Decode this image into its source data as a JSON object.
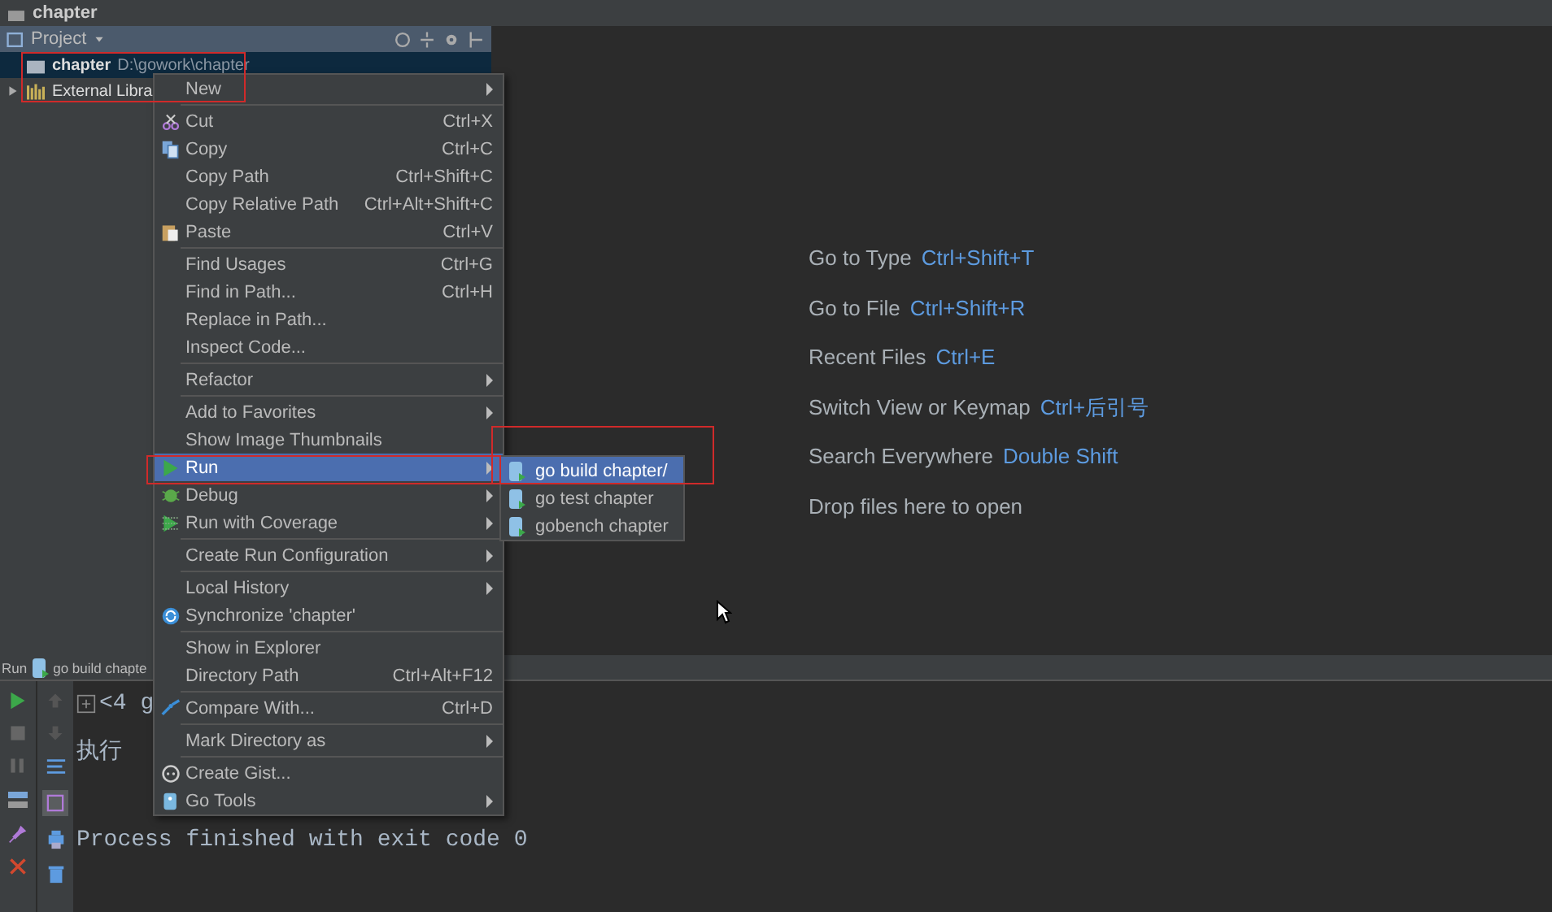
{
  "top_bar": {
    "title": "chapter"
  },
  "project_panel": {
    "title": "Project",
    "tree": [
      {
        "name": "chapter",
        "path": "D:\\gowork\\chapter",
        "selected": true,
        "expandable": false
      },
      {
        "name": "External Libra",
        "selected": false,
        "expandable": true
      }
    ]
  },
  "editor_hints": [
    {
      "label": "Go to Type",
      "shortcut": "Ctrl+Shift+T"
    },
    {
      "label": "Go to File",
      "shortcut": "Ctrl+Shift+R"
    },
    {
      "label": "Recent Files",
      "shortcut": "Ctrl+E"
    },
    {
      "label": "Switch View or Keymap",
      "shortcut": "Ctrl+后引号"
    },
    {
      "label": "Search Everywhere",
      "shortcut": "Double Shift"
    },
    {
      "label": "Drop files here to open"
    }
  ],
  "run_panel": {
    "title": "Run",
    "config": "go build chapte",
    "console": [
      "<4 g",
      "执行",
      "Process finished with exit code 0"
    ]
  },
  "context_menu": [
    {
      "kind": "item",
      "label": "New",
      "submenu": true,
      "selected": false
    },
    {
      "kind": "separator"
    },
    {
      "kind": "item",
      "label": "Cut",
      "shortcut": "Ctrl+X",
      "submenu": false,
      "selected": false
    },
    {
      "kind": "item",
      "label": "Copy",
      "shortcut": "Ctrl+C",
      "submenu": false,
      "selected": false
    },
    {
      "kind": "item",
      "label": "Copy Path",
      "shortcut": "Ctrl+Shift+C",
      "submenu": false,
      "selected": false
    },
    {
      "kind": "item",
      "label": "Copy Relative Path",
      "shortcut": "Ctrl+Alt+Shift+C",
      "submenu": false,
      "selected": false
    },
    {
      "kind": "item",
      "label": "Paste",
      "shortcut": "Ctrl+V",
      "submenu": false,
      "selected": false
    },
    {
      "kind": "separator"
    },
    {
      "kind": "item",
      "label": "Find Usages",
      "shortcut": "Ctrl+G",
      "submenu": false,
      "selected": false
    },
    {
      "kind": "item",
      "label": "Find in Path...",
      "shortcut": "Ctrl+H",
      "submenu": false,
      "selected": false
    },
    {
      "kind": "item",
      "label": "Replace in Path...",
      "submenu": false,
      "selected": false
    },
    {
      "kind": "item",
      "label": "Inspect Code...",
      "submenu": false,
      "selected": false
    },
    {
      "kind": "separator"
    },
    {
      "kind": "item",
      "label": "Refactor",
      "submenu": true,
      "selected": false
    },
    {
      "kind": "separator"
    },
    {
      "kind": "item",
      "label": "Add to Favorites",
      "submenu": true,
      "selected": false
    },
    {
      "kind": "item",
      "label": "Show Image Thumbnails",
      "submenu": false,
      "selected": false
    },
    {
      "kind": "item",
      "label": "Run",
      "submenu": true,
      "selected": true
    },
    {
      "kind": "item",
      "label": "Debug",
      "submenu": true,
      "selected": false
    },
    {
      "kind": "item",
      "label": "Run with Coverage",
      "submenu": true,
      "selected": false
    },
    {
      "kind": "separator"
    },
    {
      "kind": "item",
      "label": "Create Run Configuration",
      "submenu": true,
      "selected": false
    },
    {
      "kind": "separator"
    },
    {
      "kind": "item",
      "label": "Local History",
      "submenu": true,
      "selected": false
    },
    {
      "kind": "item",
      "label": "Synchronize 'chapter'",
      "submenu": false,
      "selected": false
    },
    {
      "kind": "separator"
    },
    {
      "kind": "item",
      "label": "Show in Explorer",
      "submenu": false,
      "selected": false
    },
    {
      "kind": "item",
      "label": "Directory Path",
      "shortcut": "Ctrl+Alt+F12",
      "submenu": false,
      "selected": false
    },
    {
      "kind": "separator"
    },
    {
      "kind": "item",
      "label": "Compare With...",
      "shortcut": "Ctrl+D",
      "submenu": false,
      "selected": false
    },
    {
      "kind": "separator"
    },
    {
      "kind": "item",
      "label": "Mark Directory as",
      "submenu": true,
      "selected": false
    },
    {
      "kind": "separator"
    },
    {
      "kind": "item",
      "label": "Create Gist...",
      "submenu": false,
      "selected": false
    },
    {
      "kind": "item",
      "label": "Go Tools",
      "submenu": true,
      "selected": false
    }
  ],
  "submenu": [
    {
      "label": "go build chapter/",
      "selected": true
    },
    {
      "label": "go test chapter",
      "selected": false
    },
    {
      "label": "gobench chapter",
      "selected": false
    }
  ]
}
